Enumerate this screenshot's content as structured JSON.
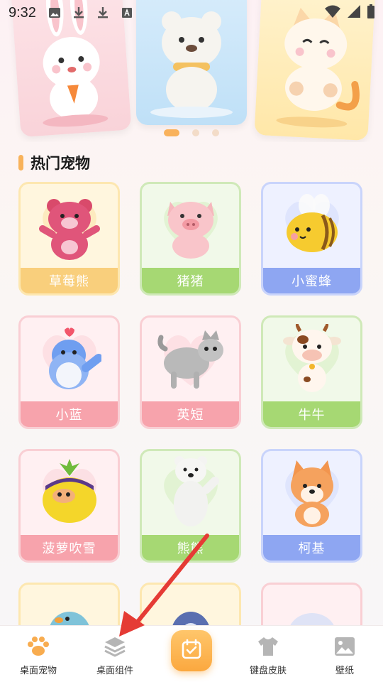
{
  "status_bar": {
    "time": "9:32",
    "icons": [
      "image-icon",
      "download-icon",
      "download-icon",
      "text-icon"
    ],
    "right_icons": [
      "wifi-icon",
      "signal-icon",
      "battery-icon"
    ]
  },
  "banner": {
    "cards": [
      "rabbit-figure",
      "bear-figure",
      "cat-figure"
    ],
    "dots": 3,
    "active_dot": 0
  },
  "section": {
    "title": "热门宠物"
  },
  "pets": [
    {
      "name": "草莓熊",
      "theme": "yellow",
      "icon": "strawberry-bear-figure"
    },
    {
      "name": "猪猪",
      "theme": "green",
      "icon": "pig-figure"
    },
    {
      "name": "小蜜蜂",
      "theme": "blue",
      "icon": "bee-figure"
    },
    {
      "name": "小蓝",
      "theme": "pink",
      "icon": "blue-bird-figure"
    },
    {
      "name": "英短",
      "theme": "pink",
      "icon": "british-shorthair-figure"
    },
    {
      "name": "牛牛",
      "theme": "green",
      "icon": "cow-figure"
    },
    {
      "name": "菠萝吹雪",
      "theme": "pink",
      "icon": "pineapple-figure"
    },
    {
      "name": "熊熊",
      "theme": "green",
      "icon": "polar-bear-figure"
    },
    {
      "name": "柯基",
      "theme": "blue",
      "icon": "corgi-figure"
    },
    {
      "name": "",
      "theme": "yellow",
      "icon": "parrot-figure"
    },
    {
      "name": "",
      "theme": "yellow",
      "icon": "penguin-figure"
    },
    {
      "name": "",
      "theme": "pink",
      "icon": "sheep-figure"
    }
  ],
  "bottom_nav": {
    "items": [
      {
        "label": "桌面宠物",
        "icon": "paw-icon",
        "active": true
      },
      {
        "label": "桌面组件",
        "icon": "layers-icon",
        "active": false
      },
      {
        "label": "",
        "icon": "calendar-icon",
        "active": false
      },
      {
        "label": "键盘皮肤",
        "icon": "tshirt-icon",
        "active": false
      },
      {
        "label": "壁纸",
        "icon": "picture-icon",
        "active": false
      }
    ]
  },
  "colors": {
    "accent": "#f9b25c",
    "arrow": "#e53b35"
  }
}
